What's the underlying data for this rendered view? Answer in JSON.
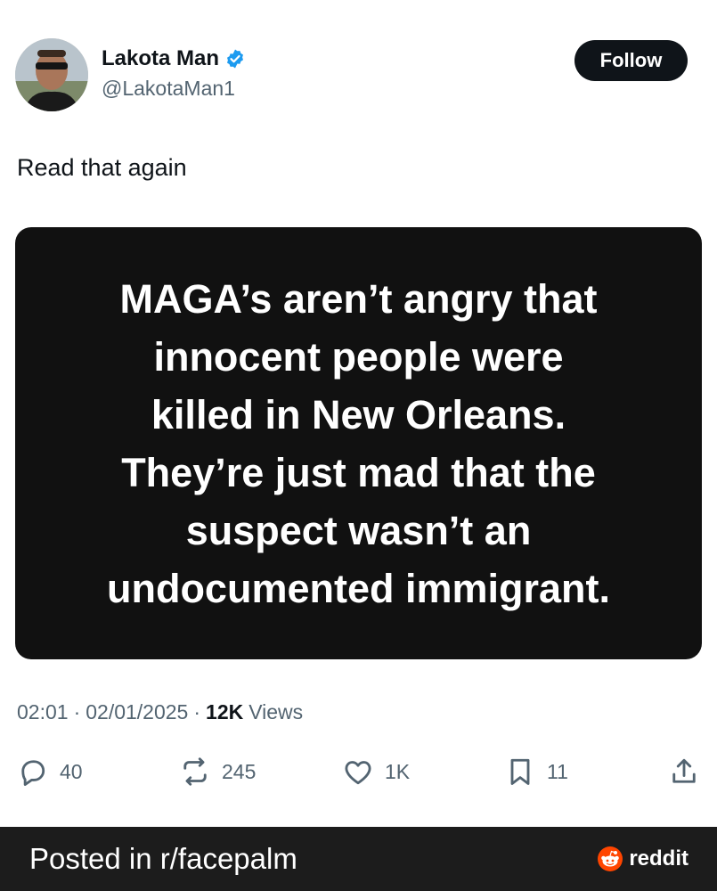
{
  "author": {
    "display_name": "Lakota Man",
    "handle": "@LakotaMan1",
    "verified": true,
    "avatar_icon": "profile-avatar"
  },
  "follow_label": "Follow",
  "tweet": {
    "text": "Read that again",
    "image_text_lines": [
      "MAGA’s aren’t angry that",
      "innocent people were",
      "killed in New Orleans.",
      "They’re just mad that the",
      "suspect wasn’t an",
      "undocumented immigrant."
    ]
  },
  "meta": {
    "time": "02:01",
    "date": "02/01/2025",
    "separator": "·",
    "views_count": "12K",
    "views_label": "Views"
  },
  "actions": {
    "replies": "40",
    "reposts": "245",
    "likes": "1K",
    "bookmarks": "11"
  },
  "footer": {
    "posted_in": "Posted in r/facepalm",
    "brand": "reddit"
  },
  "colors": {
    "verified_blue": "#1d9bf0",
    "reddit_orange": "#ff4500",
    "text_primary": "#0f1419",
    "text_secondary": "#536471"
  }
}
